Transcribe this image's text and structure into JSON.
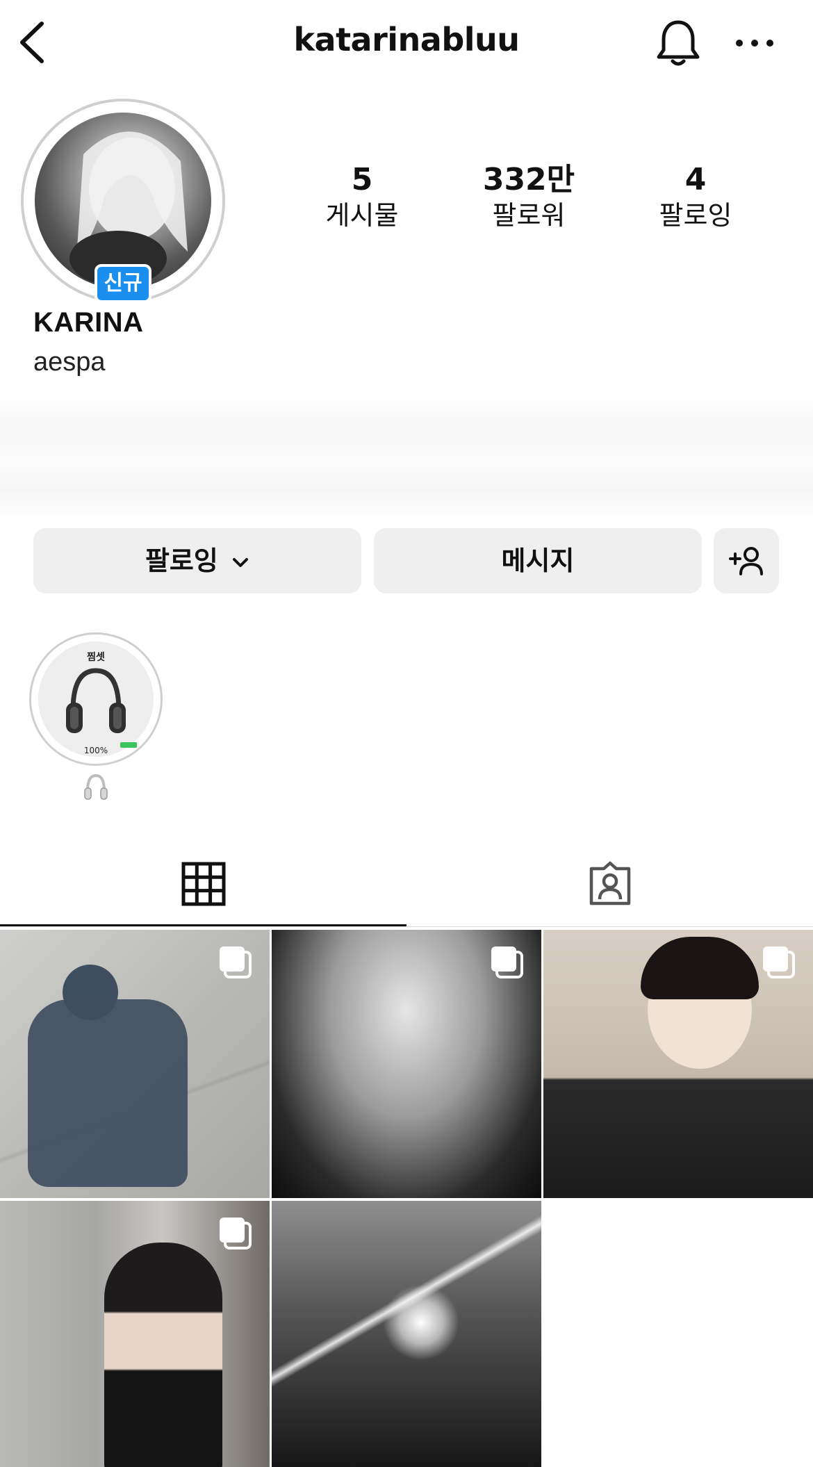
{
  "header": {
    "username": "katarinabluu"
  },
  "profile": {
    "new_badge": "신규",
    "display_name": "KARINA",
    "category": "aespa",
    "stats": {
      "posts": {
        "value": "5",
        "label": "게시물"
      },
      "followers": {
        "value": "332만",
        "label": "팔로워"
      },
      "following": {
        "value": "4",
        "label": "팔로잉"
      }
    }
  },
  "actions": {
    "following_label": "팔로잉",
    "message_label": "메시지"
  },
  "highlight": {
    "top_text": "찜셋",
    "battery_text": "100%",
    "battery_level": 1.0
  },
  "tabs": [
    {
      "name": "posts-grid",
      "icon": "grid-icon",
      "selected": true
    },
    {
      "name": "tagged",
      "icon": "tagged-user-icon",
      "selected": false
    }
  ],
  "posts": [
    {
      "id": 1,
      "multi": true
    },
    {
      "id": 2,
      "multi": true
    },
    {
      "id": 3,
      "multi": true
    },
    {
      "id": 4,
      "multi": true
    },
    {
      "id": 5,
      "multi": false
    }
  ],
  "colors": {
    "badge_blue": "#1a8ff0",
    "button_gray": "#efefef",
    "battery_green": "#3bc45a"
  }
}
